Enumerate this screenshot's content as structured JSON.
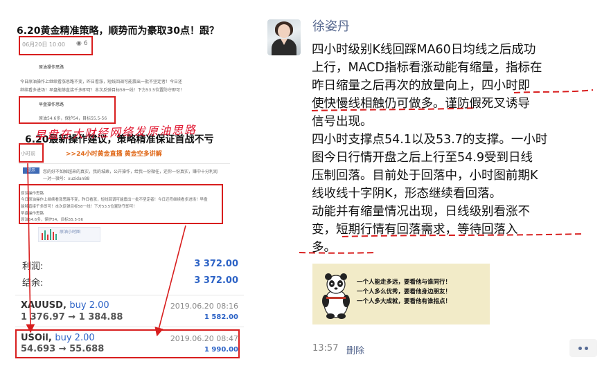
{
  "left": {
    "article_title": "6.20黄金精准策略，顺势而为豪取30点！跟？",
    "date": "06月20日 10:00",
    "views": "6",
    "section1_label": "原油操作思路",
    "section1_text_1": "今日原油操作上继续看涨思路不变，昨日看涨，短线回调可能震出一批不坚定者！今日还",
    "section1_text_2": "继续看多进场！早盘能够直接千多即可！本次反弹目标58一线！下方53.5位置防守即可！",
    "section2_label": "早盘操作思路",
    "section2_text": "原油54.6多，保护54，目标55.5-56",
    "handwritten": "早盘在大财经网络发原油思路",
    "article_title_2": "6.20最新操作建议，策略精准保证首战不亏",
    "small_hour": "小时前",
    "live_link": ">>24小时黄金直播 黄金空多讲解",
    "notice_tag": "提示",
    "notice_text_1": "您的好不如掉越来的真实，我的城乘，公开操作，给我一份微任，还你一份真实，赚中十分利润",
    "notice_text_2": "一对一微号：xuzidan88",
    "box_line_1": "原油操作思路",
    "box_line_2": "今日原油操作上继续看涨思路不变，昨日看涨，短线回调可能震出一批不坚定者！今日还符继续看多进场！早盘",
    "box_line_3": "能够直接千多即可！本次反弹目标58一线！下方53.5位置防守即可！",
    "box_line_4": "早盘操作思路",
    "box_line_5": "原油54.6多，保护54，目标55.5-56",
    "chart_label": "原油小时图",
    "profit_label": "利润:",
    "profit_value": "3 372.00",
    "balance_label": "结余:",
    "balance_value": "3 372.00",
    "trades": [
      {
        "symbol": "XAUUSD,",
        "side": "buy 2.00",
        "datetime": "2019.06.20 08:16",
        "price": "1 376.97 → 1 384.88",
        "pnl": "1 582.00"
      },
      {
        "symbol": "USOil,",
        "side": "buy 2.00",
        "datetime": "2019.06.20 08:47",
        "price": "54.693 → 55.688",
        "pnl": "1 990.00"
      }
    ]
  },
  "right": {
    "author": "徐姿丹",
    "post_lines": [
      "四小时级别K线回踩MA60日均线之后成功",
      "上行，MACD指标看涨动能有缩量，指标在",
      "昨日缩量之后再次的放量向上，四小时即",
      "使快慢线相触仍可做多。谨防假死叉诱导",
      "信号出现。",
      "四小时支撑点54.1以及53.7的支撑。一小时",
      "图今日行情开盘之后上行至54.9受到日线",
      "压制回落。目前处于回落中，小时图前期K",
      "线收线十字阴K，形态继续看回落。",
      "动能并有缩量情况出现，日线级别看涨不",
      "变，短期行情有回落需求，等待回落入",
      "多。"
    ],
    "meme_quotes": [
      "一个人能走多远，要看他与谁同行！",
      "一个人多么优秀，要看他身边朋友！",
      "一个人多大成就，要看他有谁指点！"
    ],
    "time": "13:57",
    "delete_label": "删除"
  },
  "colors": {
    "annotation_red": "#d81e1e",
    "link_blue": "#57688f",
    "value_blue": "#2d63c6"
  }
}
